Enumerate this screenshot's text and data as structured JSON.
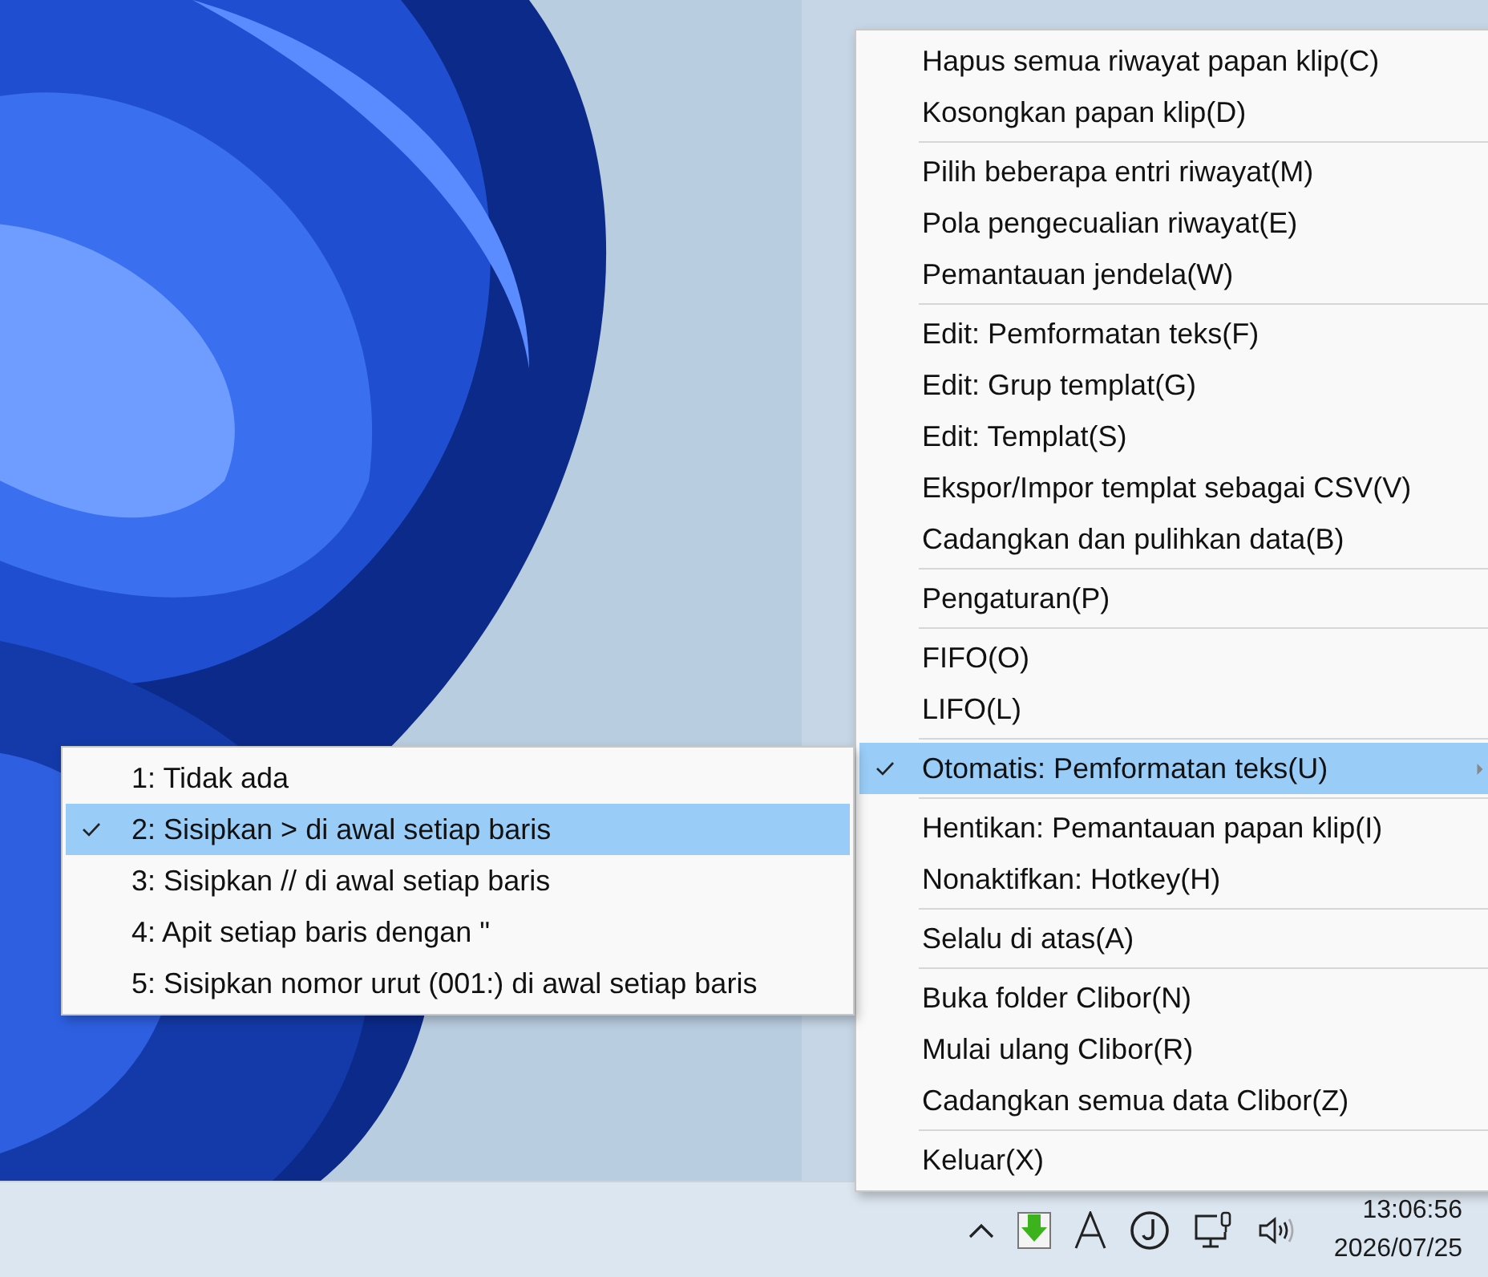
{
  "menu": {
    "items": [
      {
        "kind": "item",
        "label": "Hapus semua riwayat papan klip(C)",
        "checked": false,
        "selected": false,
        "submenu": false
      },
      {
        "kind": "item",
        "label": "Kosongkan papan klip(D)",
        "checked": false,
        "selected": false,
        "submenu": false
      },
      {
        "kind": "separator"
      },
      {
        "kind": "item",
        "label": "Pilih beberapa entri riwayat(M)",
        "checked": false,
        "selected": false,
        "submenu": false
      },
      {
        "kind": "item",
        "label": "Pola pengecualian riwayat(E)",
        "checked": false,
        "selected": false,
        "submenu": false
      },
      {
        "kind": "item",
        "label": "Pemantauan jendela(W)",
        "checked": false,
        "selected": false,
        "submenu": false
      },
      {
        "kind": "separator"
      },
      {
        "kind": "item",
        "label": "Edit: Pemformatan teks(F)",
        "checked": false,
        "selected": false,
        "submenu": false
      },
      {
        "kind": "item",
        "label": "Edit: Grup templat(G)",
        "checked": false,
        "selected": false,
        "submenu": false
      },
      {
        "kind": "item",
        "label": "Edit: Templat(S)",
        "checked": false,
        "selected": false,
        "submenu": false
      },
      {
        "kind": "item",
        "label": "Ekspor/Impor templat sebagai CSV(V)",
        "checked": false,
        "selected": false,
        "submenu": false
      },
      {
        "kind": "item",
        "label": "Cadangkan dan pulihkan data(B)",
        "checked": false,
        "selected": false,
        "submenu": false
      },
      {
        "kind": "separator"
      },
      {
        "kind": "item",
        "label": "Pengaturan(P)",
        "checked": false,
        "selected": false,
        "submenu": false
      },
      {
        "kind": "separator"
      },
      {
        "kind": "item",
        "label": "FIFO(O)",
        "checked": false,
        "selected": false,
        "submenu": false
      },
      {
        "kind": "item",
        "label": "LIFO(L)",
        "checked": false,
        "selected": false,
        "submenu": false
      },
      {
        "kind": "separator"
      },
      {
        "kind": "item",
        "label": "Otomatis: Pemformatan teks(U)",
        "checked": true,
        "selected": true,
        "submenu": true
      },
      {
        "kind": "separator"
      },
      {
        "kind": "item",
        "label": "Hentikan: Pemantauan papan klip(I)",
        "checked": false,
        "selected": false,
        "submenu": false
      },
      {
        "kind": "item",
        "label": "Nonaktifkan: Hotkey(H)",
        "checked": false,
        "selected": false,
        "submenu": false
      },
      {
        "kind": "separator"
      },
      {
        "kind": "item",
        "label": "Selalu di atas(A)",
        "checked": false,
        "selected": false,
        "submenu": false
      },
      {
        "kind": "separator"
      },
      {
        "kind": "item",
        "label": "Buka folder Clibor(N)",
        "checked": false,
        "selected": false,
        "submenu": false
      },
      {
        "kind": "item",
        "label": "Mulai ulang Clibor(R)",
        "checked": false,
        "selected": false,
        "submenu": false
      },
      {
        "kind": "item",
        "label": "Cadangkan semua data Clibor(Z)",
        "checked": false,
        "selected": false,
        "submenu": false
      },
      {
        "kind": "separator"
      },
      {
        "kind": "item",
        "label": "Keluar(X)",
        "checked": false,
        "selected": false,
        "submenu": false
      }
    ]
  },
  "submenu": {
    "items": [
      {
        "label": "1: Tidak ada",
        "checked": false,
        "selected": false
      },
      {
        "label": "2: Sisipkan > di awal setiap baris",
        "checked": true,
        "selected": true
      },
      {
        "label": "3: Sisipkan // di awal setiap baris",
        "checked": false,
        "selected": false
      },
      {
        "label": "4: Apit setiap baris dengan \"",
        "checked": false,
        "selected": false
      },
      {
        "label": "5: Sisipkan nomor urut (001:) di awal setiap baris",
        "checked": false,
        "selected": false
      }
    ]
  },
  "taskbar": {
    "clock": {
      "time": "13:06:56",
      "date": "2026/07/25"
    }
  }
}
